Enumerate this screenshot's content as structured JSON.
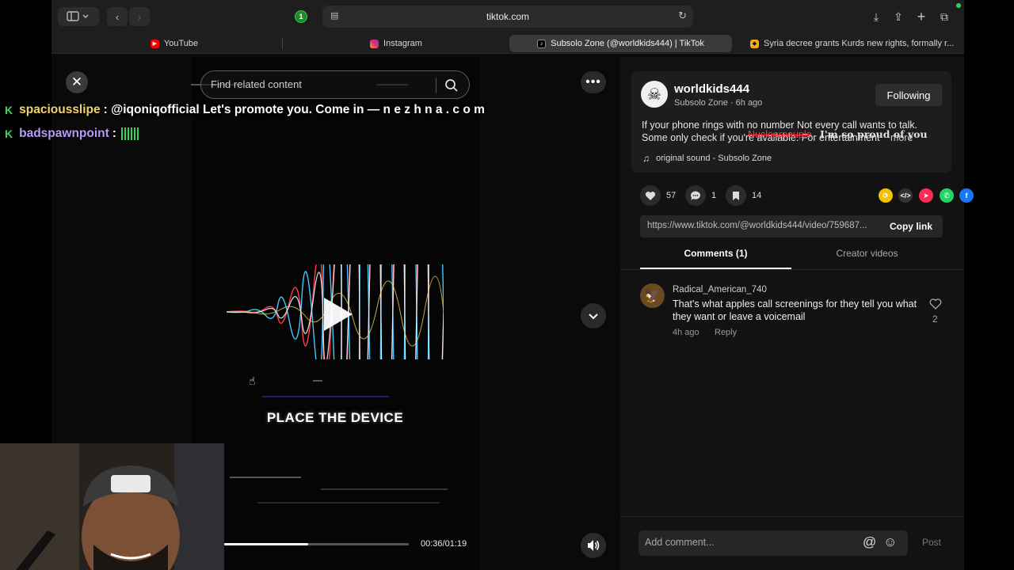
{
  "browser": {
    "url": "tiktok.com",
    "extension_badge": "1",
    "tabs": [
      {
        "label": "YouTube",
        "icon": "youtube-icon",
        "color": "#ff0000"
      },
      {
        "label": "Instagram",
        "icon": "instagram-icon",
        "color": "#e1306c"
      },
      {
        "label": "Subsolo Zone (@worldkids444) | TikTok",
        "icon": "tiktok-icon",
        "color": "#ffffff"
      },
      {
        "label": "Syria decree grants Kurds new rights, formally r...",
        "icon": "news-icon",
        "color": "#f5a623"
      }
    ]
  },
  "video": {
    "search_placeholder": "Find related content",
    "caption": "PLACE THE DEVICE",
    "time": "00:36/01:19",
    "progress": 0.456
  },
  "post": {
    "author": "worldkids444",
    "nickname_time": "Subsolo Zone · 6h ago",
    "follow_label": "Following",
    "description": "If your phone rings with no number Not every call wants to talk. Some only check if you're available. For entertainment",
    "more_label": "more",
    "sound": "original sound - Subsolo Zone",
    "overlay_red": "Nuclearpeuple",
    "overlay_white": "I'm so proud of you",
    "likes": "57",
    "comments": "1",
    "saves": "14",
    "link": "https://www.tiktok.com/@worldkids444/video/759687...",
    "copy_link": "Copy link",
    "tab_comments": "Comments (1)",
    "tab_creator": "Creator videos"
  },
  "comment": {
    "user": "Radical_American_740",
    "text": "That's what apples call screenings for they tell you what they want or leave a voicemail",
    "time": "4h ago",
    "reply": "Reply",
    "likes": "2"
  },
  "composer": {
    "placeholder": "Add comment...",
    "post_label": "Post"
  },
  "stream_chat": [
    {
      "user": "spaciousslipe",
      "message": ": @iqoniqofficial Let's promote you. Come in — n e z h n a . c o m"
    },
    {
      "user": "badspawnpoint",
      "message": ":"
    }
  ]
}
